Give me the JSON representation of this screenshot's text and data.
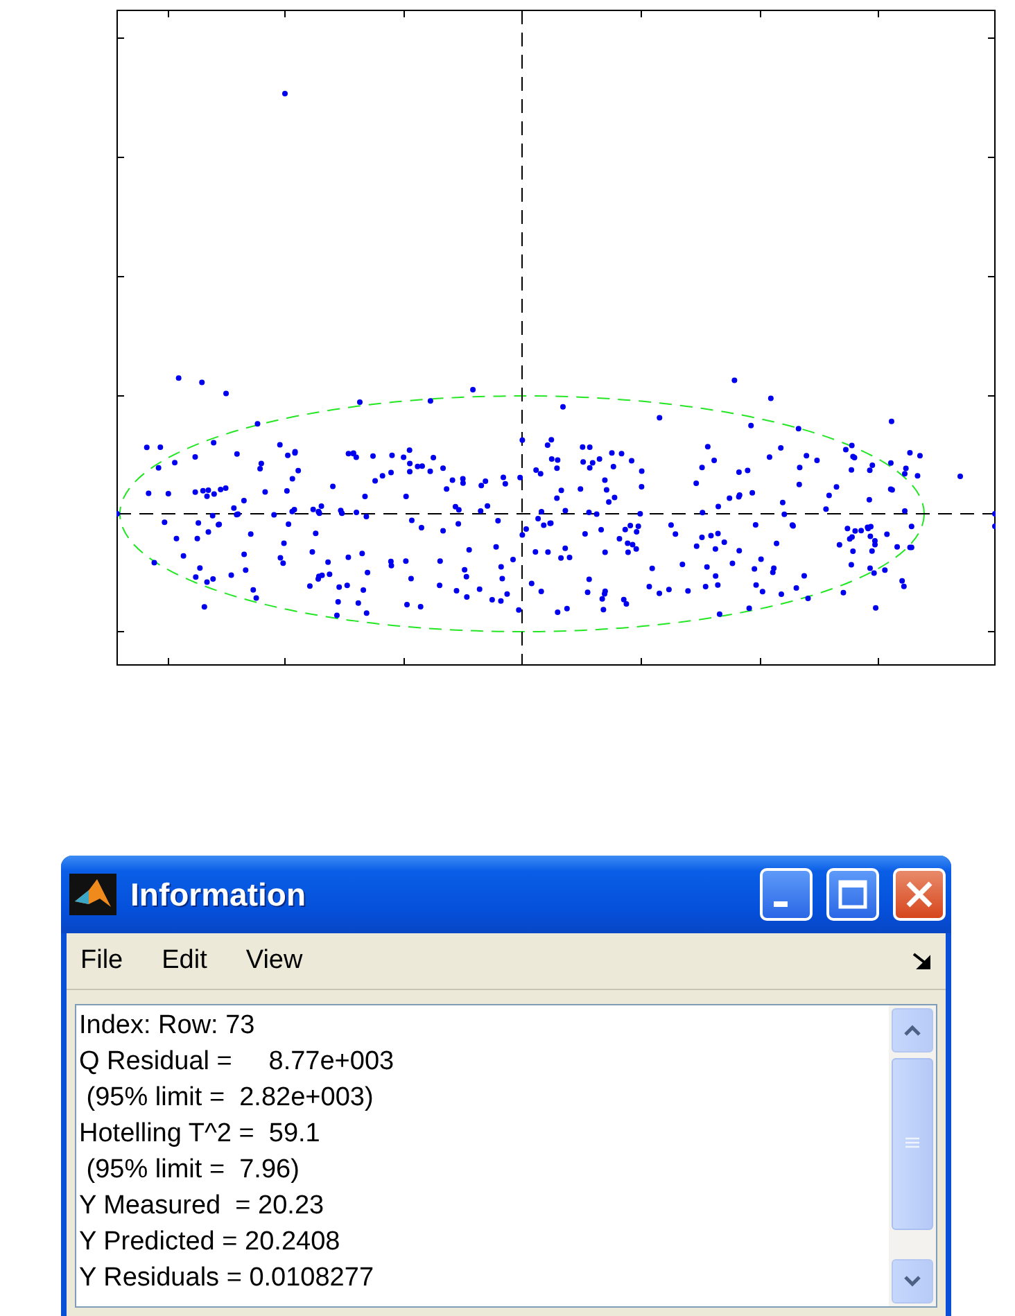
{
  "window": {
    "title": "Information",
    "menu": [
      "File",
      "Edit",
      "View"
    ],
    "lines": [
      "Index: Row: 73",
      "Q Residual =     8.77e+003",
      " (95% limit =  2.82e+003)",
      "Hotelling T^2 =  59.1",
      " (95% limit =  7.96)",
      "Y Measured  = 20.23",
      "Y Predicted = 20.2408",
      "Y Residuals = 0.0108277"
    ]
  }
}
